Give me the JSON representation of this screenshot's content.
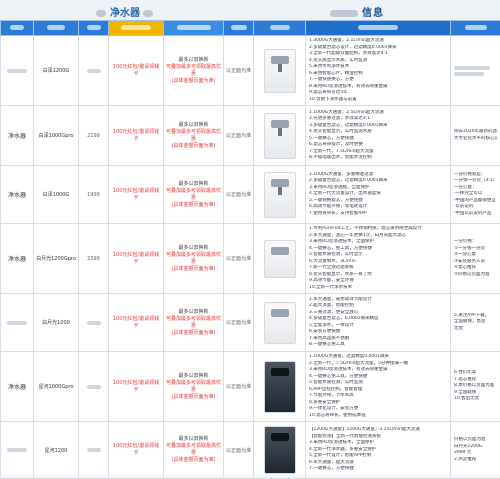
{
  "header": {
    "left_title": "净水器",
    "right_title": "信息"
  },
  "columns": {
    "brand": "品牌",
    "model": "型号",
    "price": "价格",
    "promo": "促销",
    "shipping": "发货",
    "image": "图片",
    "info": "信息",
    "notes": "备注"
  },
  "rows": [
    {
      "brand": "",
      "model": "白泽1200G",
      "price": "",
      "promo1": "100元红包/邀请领钱卡",
      "gift1": "最多以旧换新",
      "gift2": "可叠加最多可领取最高优惠",
      "gift3": "(具体金额页面为准)",
      "ship": "以正面为准",
      "desc": [
        "1.3000G大通量，2.1L/min超大流速",
        "2.多级复合滤芯设计，过滤精度0.0001微米",
        "3.全新一代超级双膜结构，水效高达4:1",
        "4.龙头屏显示水质，实时监测",
        "5.采用专利净水技术",
        "6.采用智能芯片，精准控制",
        "7.一键快速换芯，方便",
        "8.采用RO反渗透技术，有效去除重金属",
        "9.滤芯寿命可达5年",
        "10.含厨下净水器与前置"
      ],
      "note": [
        ""
      ]
    },
    {
      "brand": "净水器",
      "model": "白泽1000Gpro",
      "price": "2199",
      "promo1": "100元红包/邀请领钱卡",
      "gift1": "最多以旧换新",
      "gift2": "可叠加最多可领取最高优惠",
      "gift3": "(具体金额页面为准)",
      "ship": "以正面为准",
      "desc": [
        "1.1000G大通量，2.5L/min超大流速",
        "2.先进多重过滤，水效高达3:1",
        "3.多级复合滤芯，过滤精度0.0001微米",
        "4.龙头智能显示，实时监测水质",
        "5.一键换芯，方便快捷",
        "6.滤芯寿命提示，及时更换",
        "7.全新一代，7.5L/min超大流量",
        "8.不插电版出水，智能水流控制",
        "9.智能APP控制，远程管理",
        "10.采用RO反渗透技术，过滤更彻底"
      ],
      "note": [
        "除去2020年最新的滤网系统，相",
        "大专业化水平的核心竞争力"
      ]
    },
    {
      "brand": "净水器",
      "model": "白泽1000G",
      "price": "1999",
      "promo1": "100元红包/邀请领钱卡",
      "gift1": "最多以旧换新",
      "gift2": "可叠加最多可领取最高优惠",
      "gift3": "(具体金额页面为准)",
      "ship": "以正面为准",
      "desc": [
        "1.1000G大通量，多重精准过滤",
        "2.多级复合滤芯，过滤精度0.0001微米",
        "3.采用RO反渗透膜，全面保护",
        "4.全新一代大流量设计，出水速度快",
        "5.一键快换滤芯，方便快捷",
        "6.高效节能环保，零电耗设计",
        "7.使用寿命长，支持智能APP"
      ],
      "note": [
        "一分价格就是：",
        "一分钱一分货（3:1）",
        "一分心意：",
        "·一样完全可以",
        "·中国的产品都很便宜",
        "·以前说的",
        "·中国以前说的产品"
      ]
    },
    {
      "brand": "净水器",
      "model": "白月光1200Gpro",
      "price": "2399",
      "promo1": "100元红包/邀请领钱卡",
      "gift1": "最多以旧换新",
      "gift2": "可叠加最多可领取最高优惠",
      "gift3": "(具体金额页面为准)",
      "ship": "以正面为准",
      "desc": [
        "1.专利PureFlat工艺，不锈钢材质，滤芯采用防泄漏设计",
        "2.率大通量，滤芯一年更换1次，白月光超大滤芯",
        "3.采用RO反渗透技术，全面保护",
        "4.一键换芯，免工具，方便快捷",
        "5.智能水质检测，实时显示",
        "6.大流量制水，3L/min",
        "7.新一代全效过滤系统",
        "8.龙头智能显示，水质一目了然",
        "9.高效节能，安全环保",
        "10.全新一代净水技术"
      ],
      "note": [
        "一分价格：",
        "①一分钱一分货",
        "②一分心意",
        "③安装服务人员",
        "④滤芯推荐",
        "⑤价格以页面为准"
      ]
    },
    {
      "brand": "",
      "model": "白月光1000",
      "price": "",
      "promo1": "100元红包/邀请领钱卡",
      "gift1": "最多以旧换新",
      "gift2": "可叠加最多可领取最高优惠",
      "gift3": "(具体金额页面为准)",
      "ship": "以正面为准",
      "desc": [
        "1.率大通量，采用高效节能设计",
        "2.超大流量，智能控制",
        "3.三重过滤，更安全放心",
        "4.多级复合滤芯，0.0001微米精度",
        "5.全屋净水，一体设计",
        "6.安装方便快捷",
        "7.采用高品质不锈钢",
        "8.一键换芯免工具"
      ],
      "note": [
        "5.关注APP下载，",
        "全国联保，售后",
        "无忧"
      ]
    },
    {
      "brand": "净水器",
      "model": "星河1000Gpro",
      "price": "",
      "promo1": "100元红包/邀请领钱卡",
      "gift1": "最多以旧换新",
      "gift2": "可叠加最多可领取最高优惠",
      "gift3": "(具体金额页面为准)",
      "ship": "以正面为准",
      "desc": [
        "1.1000G大通量，过滤精度0.0001微米",
        "2.全新一代，7.5L/min超大流量，5分钟接满一桶",
        "3.采用RO反渗透技术，有效去除重金属",
        "4.一键换芯免工具，方便快捷",
        "5.智能水质检测，实时监测",
        "6.APP远程控制，智能管理",
        "7.节能环保，节水率高",
        "8.多重安全保护",
        "9.一体化设计，安装方便",
        "10.滤芯寿命长，使用成本低"
      ],
      "note": [
        "6.性价比高",
        "7.滤芯推荐",
        "8.本价格以页面为准",
        "9.全国联保",
        "10.售后无忧"
      ]
    },
    {
      "brand": "",
      "model": "星河1200",
      "price": "",
      "promo1": "100元红包/邀请领钱卡",
      "gift1": "最多以旧换新",
      "gift2": "可叠加最多可领取最高优惠",
      "gift3": "(具体金额页面为准)",
      "ship": "以正面为准",
      "desc": [
        "【1200G大通量】1200G大通量，3.15L/min超大流速",
        "【智能检测】全新一代智能检测系统",
        "3.采用RO反渗透技术，全面保护",
        "4.全新一代净水器，多重安全保护",
        "5.全新一代设计，智能APP控制",
        "6.率大通量，超大流速",
        "7.一键换芯，方便快捷"
      ],
      "note": [
        "价格以页面为准",
        "白月光1200G",
        "2999 元",
        "2.热卖推荐"
      ]
    }
  ]
}
